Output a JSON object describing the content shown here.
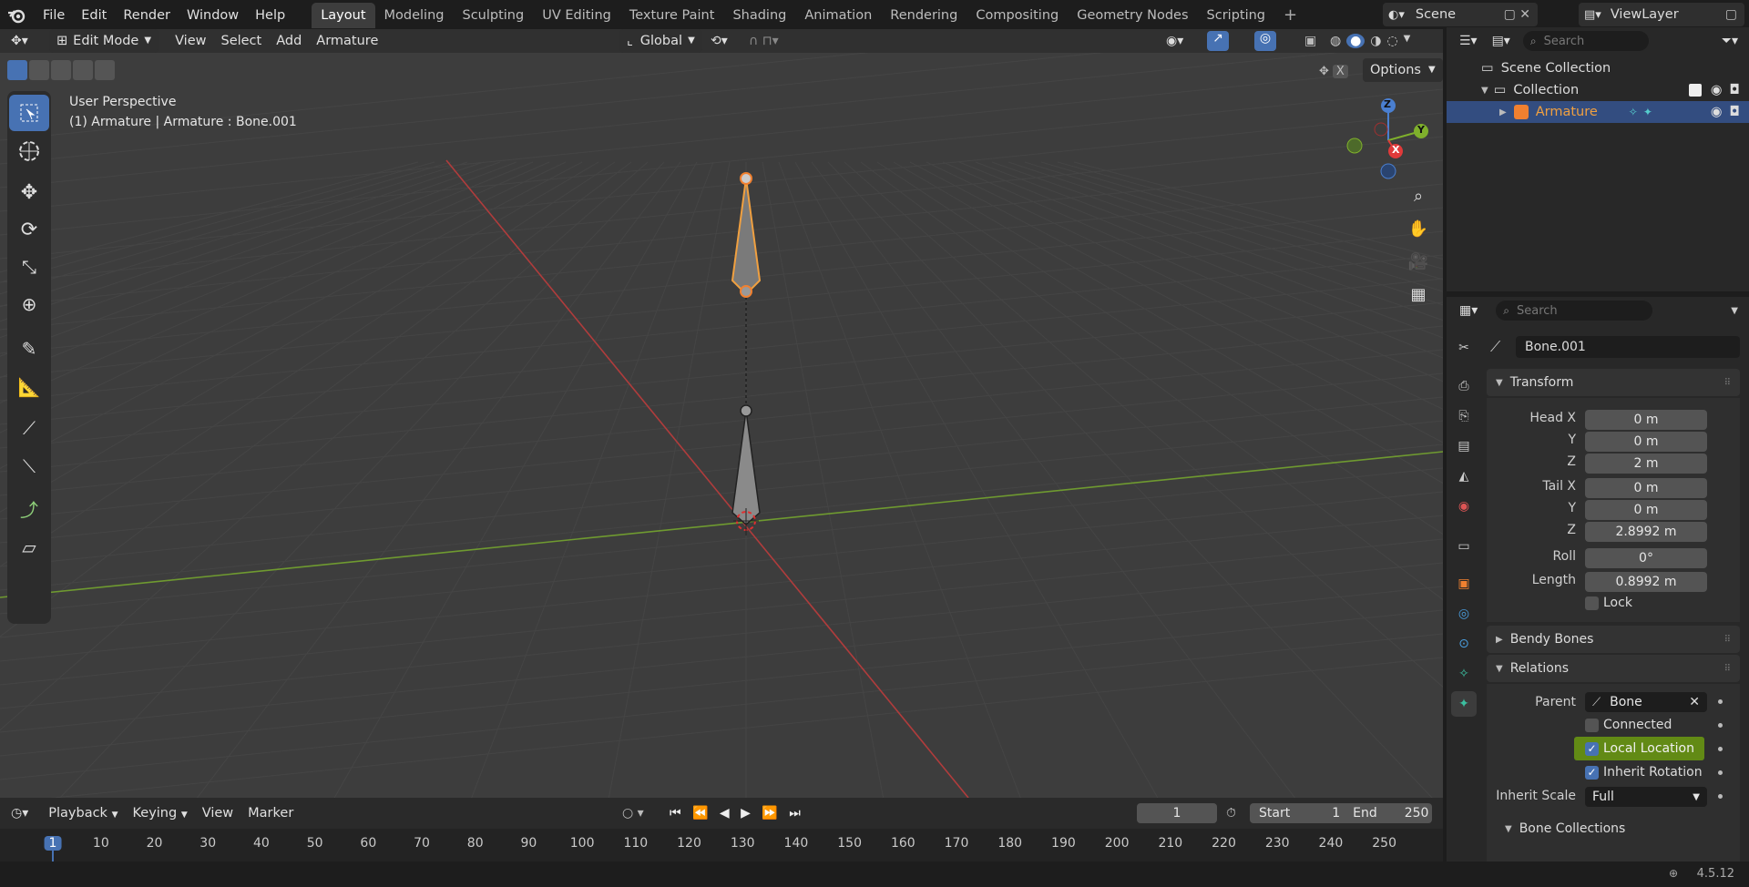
{
  "menubar": {
    "items": [
      "File",
      "Edit",
      "Render",
      "Window",
      "Help"
    ],
    "workspaces": [
      "Layout",
      "Modeling",
      "Sculpting",
      "UV Editing",
      "Texture Paint",
      "Shading",
      "Animation",
      "Rendering",
      "Compositing",
      "Geometry Nodes",
      "Scripting"
    ],
    "active_workspace": "Layout",
    "scene": "Scene",
    "view_layer": "ViewLayer"
  },
  "viewport_header": {
    "mode": "Edit Mode",
    "menus": [
      "View",
      "Select",
      "Add",
      "Armature"
    ],
    "orientation": "Global",
    "options_label": "Options",
    "x_label": "X"
  },
  "viewport": {
    "perspective": "User Perspective",
    "object_info": "(1) Armature | Armature : Bone.001",
    "gizmo_axes": {
      "z": "Z",
      "y": "Y",
      "x": "X"
    }
  },
  "outliner": {
    "search_placeholder": "Search",
    "scene_collection": "Scene Collection",
    "collection": "Collection",
    "armature": "Armature"
  },
  "properties": {
    "search_placeholder": "Search",
    "bone_name": "Bone.001",
    "transform": {
      "title": "Transform",
      "head_x_label": "Head X",
      "head_x": "0 m",
      "head_y_label": "Y",
      "head_y": "0 m",
      "head_z_label": "Z",
      "head_z": "2 m",
      "tail_x_label": "Tail X",
      "tail_x": "0 m",
      "tail_y_label": "Y",
      "tail_y": "0 m",
      "tail_z_label": "Z",
      "tail_z": "2.8992 m",
      "roll_label": "Roll",
      "roll": "0°",
      "length_label": "Length",
      "length": "0.8992 m",
      "lock_label": "Lock"
    },
    "bendy_bones": "Bendy Bones",
    "relations": {
      "title": "Relations",
      "parent_label": "Parent",
      "parent": "Bone",
      "connected": "Connected",
      "local_location": "Local Location",
      "inherit_rotation": "Inherit Rotation",
      "inherit_scale_label": "Inherit Scale",
      "inherit_scale": "Full",
      "bone_collections": "Bone Collections"
    }
  },
  "timeline": {
    "menus": [
      "Playback",
      "Keying",
      "View",
      "Marker"
    ],
    "current_frame": "1",
    "start_label": "Start",
    "start": "1",
    "end_label": "End",
    "end": "250",
    "ruler": [
      "1",
      "10",
      "20",
      "30",
      "40",
      "50",
      "60",
      "70",
      "80",
      "90",
      "100",
      "110",
      "120",
      "130",
      "140",
      "150",
      "160",
      "170",
      "180",
      "190",
      "200",
      "210",
      "220",
      "230",
      "240",
      "250"
    ]
  },
  "status": {
    "version": "4.5.12"
  },
  "colors": {
    "accent": "#4772b3",
    "highlight": "#8fb51a",
    "bone_select": "#f0a040"
  }
}
